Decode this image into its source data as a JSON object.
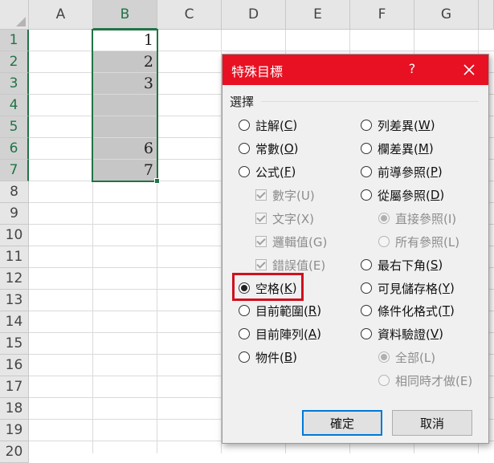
{
  "spreadsheet": {
    "columns": [
      "A",
      "B",
      "C",
      "D",
      "E",
      "F",
      "G"
    ],
    "rows": [
      "1",
      "2",
      "3",
      "4",
      "5",
      "6",
      "7",
      "8",
      "9",
      "10",
      "11",
      "12",
      "13",
      "14",
      "15",
      "16",
      "17",
      "18",
      "19",
      "20"
    ],
    "cells_b": [
      "1",
      "2",
      "3",
      "",
      "",
      "6",
      "7"
    ],
    "colors": {
      "selection": "#217346",
      "selected_fill": "#c6c6c6"
    }
  },
  "dialog": {
    "title": "特殊目標",
    "help": "?",
    "group_label": "選擇",
    "left_options": [
      {
        "pre": "註解(",
        "key": "C",
        "post": ")"
      },
      {
        "pre": "常數(",
        "key": "O",
        "post": ")"
      },
      {
        "pre": "公式(",
        "key": "F",
        "post": ")"
      },
      {
        "pre": "數字(U)",
        "key": "",
        "post": ""
      },
      {
        "pre": "文字(X)",
        "key": "",
        "post": ""
      },
      {
        "pre": "邏輯值(G)",
        "key": "",
        "post": ""
      },
      {
        "pre": "錯誤值(E)",
        "key": "",
        "post": ""
      },
      {
        "pre": "空格(",
        "key": "K",
        "post": ")"
      },
      {
        "pre": "目前範圍(",
        "key": "R",
        "post": ")"
      },
      {
        "pre": "目前陣列(",
        "key": "A",
        "post": ")"
      },
      {
        "pre": "物件(",
        "key": "B",
        "post": ")"
      }
    ],
    "right_options": [
      {
        "pre": "列差異(",
        "key": "W",
        "post": ")"
      },
      {
        "pre": "欄差異(",
        "key": "M",
        "post": ")"
      },
      {
        "pre": "前導參照(",
        "key": "P",
        "post": ")"
      },
      {
        "pre": "從屬參照(",
        "key": "D",
        "post": ")"
      },
      {
        "pre": "直接參照(I)",
        "key": "",
        "post": ""
      },
      {
        "pre": "所有參照(L)",
        "key": "",
        "post": ""
      },
      {
        "pre": "最右下角(",
        "key": "S",
        "post": ")"
      },
      {
        "pre": "可見儲存格(",
        "key": "Y",
        "post": ")"
      },
      {
        "pre": "條件化格式(",
        "key": "T",
        "post": ")"
      },
      {
        "pre": "資料驗證(",
        "key": "V",
        "post": ")"
      },
      {
        "pre": "全部(L)",
        "key": "",
        "post": ""
      },
      {
        "pre": "相同時才做(E)",
        "key": "",
        "post": ""
      }
    ],
    "ok_label": "確定",
    "cancel_label": "取消",
    "colors": {
      "titlebar": "#e81123",
      "highlight": "#d0101e",
      "default_button_border": "#0078d7"
    }
  }
}
